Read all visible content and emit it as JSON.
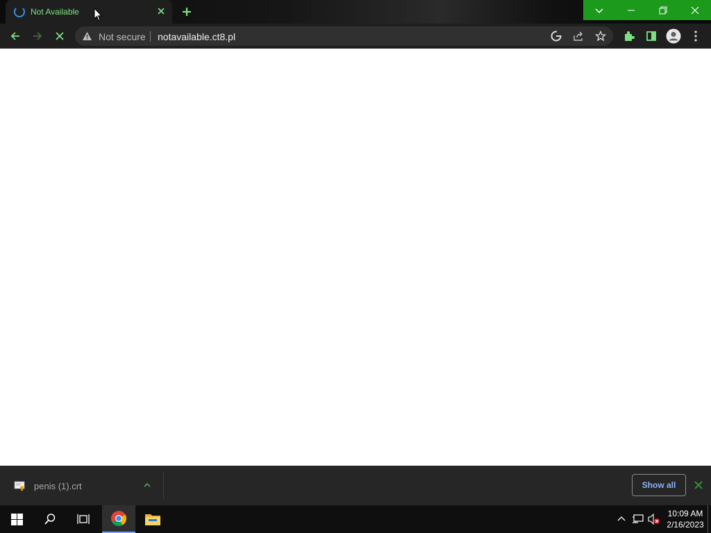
{
  "browser": {
    "tab": {
      "title": "Not Available",
      "loading": true
    },
    "address": {
      "security_label": "Not secure",
      "url": "notavailable.ct8.pl"
    }
  },
  "icons": {
    "tab_spinner": "loading-spinner-icon",
    "tab_close": "close-icon",
    "new_tab": "plus-icon",
    "tab_search": "chevron-down-icon",
    "minimize": "minimize-icon",
    "restore": "restore-icon",
    "window_close": "close-icon",
    "back": "arrow-left-icon",
    "forward": "arrow-right-icon",
    "stop": "stop-icon",
    "warning": "warning-icon",
    "google": "google-icon",
    "share": "share-icon",
    "bookmark": "star-icon",
    "extensions": "puzzle-icon",
    "side_panel": "side-panel-icon",
    "profile": "profile-icon",
    "menu": "kebab-menu-icon"
  },
  "download_shelf": {
    "file_name": "penis (1).crt",
    "show_all_label": "Show all"
  },
  "taskbar": {
    "time": "10:09 AM",
    "date": "2/16/2023"
  },
  "colors": {
    "accent_green": "#1c9a1c",
    "tab_text": "#7ee081",
    "link_blue": "#8ab4f8"
  }
}
